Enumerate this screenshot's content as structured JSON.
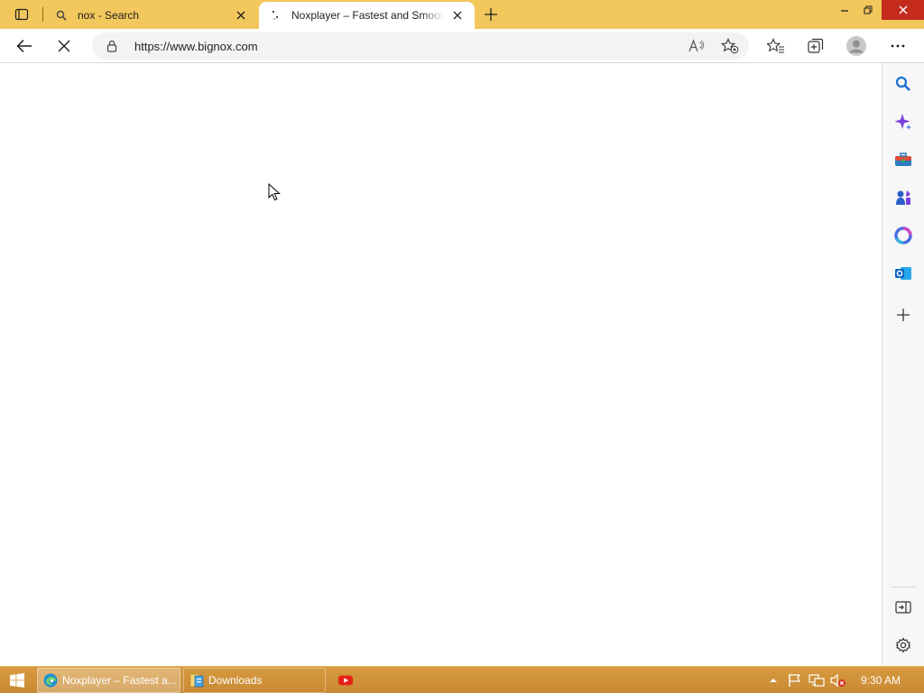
{
  "browser": {
    "tabs": [
      {
        "title": "nox - Search",
        "icon": "search-icon",
        "active": false
      },
      {
        "title": "Noxplayer – Fastest and Smoothest Android Emulator",
        "icon": "loading-icon",
        "active": true
      }
    ],
    "address": {
      "url": "https://www.bignox.com"
    },
    "colors": {
      "tabbar": "#f2c75c",
      "close": "#c42b1c"
    }
  },
  "sidebar": {
    "items": [
      "search-icon",
      "copilot-icon",
      "tools-icon",
      "games-icon",
      "office-icon",
      "outlook-icon",
      "add-icon"
    ],
    "bottom": [
      "hide-sidebar-icon",
      "settings-icon"
    ]
  },
  "taskbar": {
    "tasks": [
      {
        "label": "Noxplayer – Fastest a...",
        "icon": "edge-icon"
      },
      {
        "label": "Downloads",
        "icon": "folder-icon"
      },
      {
        "label": "",
        "icon": "youtube-icon"
      }
    ],
    "clock": "9:30 AM"
  }
}
